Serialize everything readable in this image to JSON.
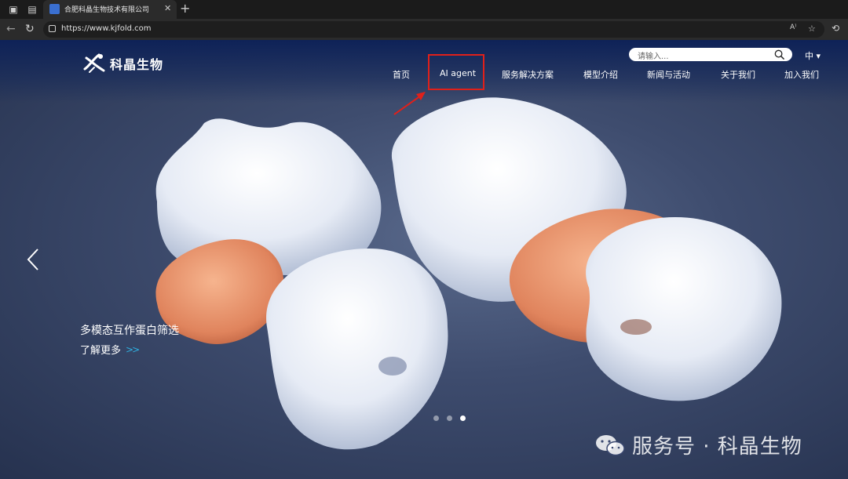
{
  "browser": {
    "tab_title": "合肥科晶生物技术有限公司",
    "tab_close": "✕",
    "new_tab": "+",
    "url": "https://www.kjfold.com",
    "read_aloud": "A⁾"
  },
  "site": {
    "logo_text": "科晶生物",
    "search_placeholder": "请输入...",
    "language": "中 ▾",
    "nav": [
      "首页",
      "AI agent",
      "服务解决方案",
      "模型介绍",
      "新闻与活动",
      "关于我们",
      "加入我们"
    ],
    "slide_caption": "多模态互作蛋白筛选",
    "learn_more": "了解更多",
    "carousel": {
      "count": 3,
      "active_index": 2
    },
    "colors": {
      "highlight": "#e0201a",
      "accent": "#2fb0e0"
    }
  },
  "watermark": {
    "text": "服务号 · 科晶生物"
  }
}
